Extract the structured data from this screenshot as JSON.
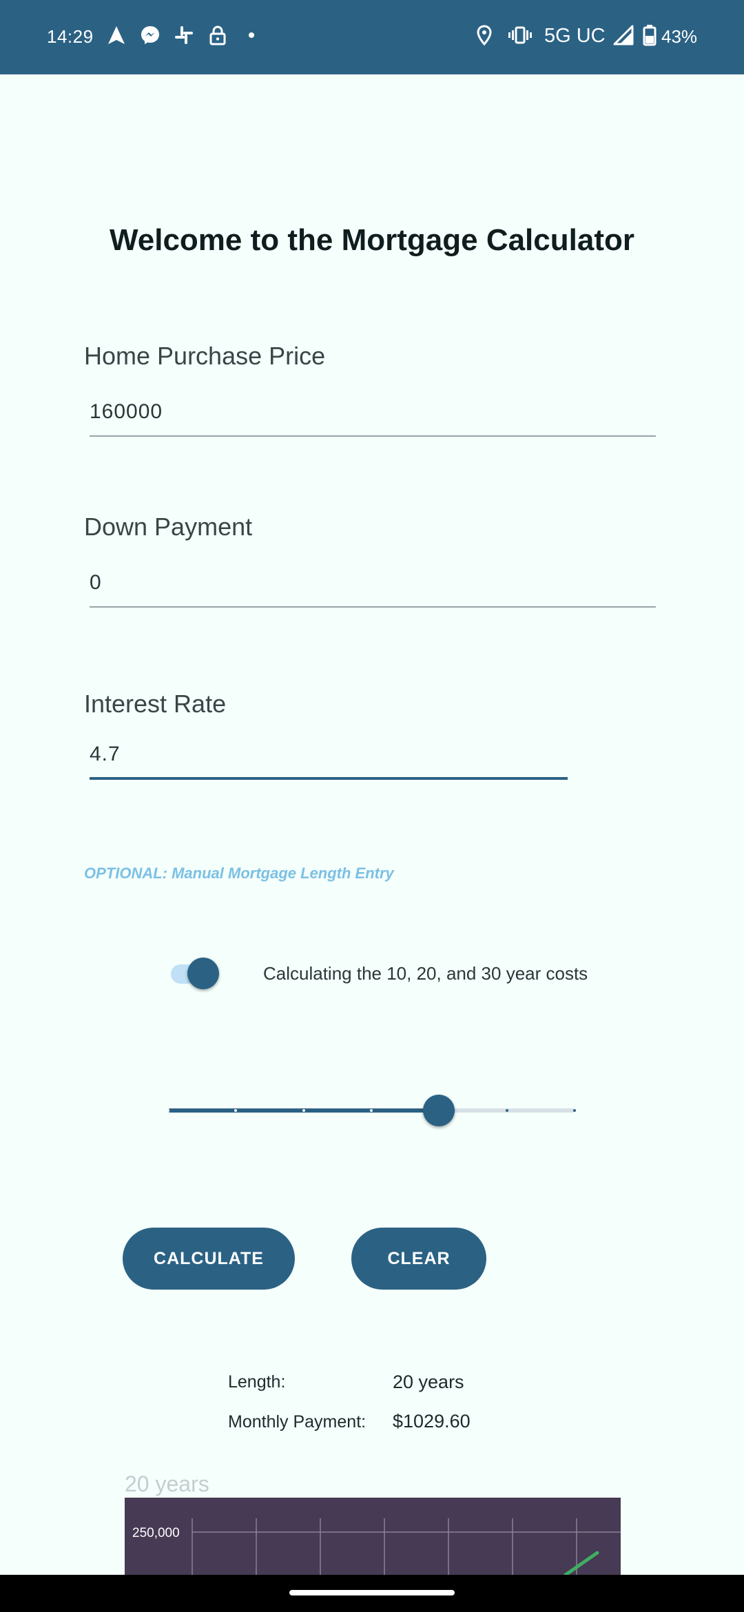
{
  "status_bar": {
    "time": "14:29",
    "network": "5G UC",
    "battery": "43%"
  },
  "page": {
    "title": "Welcome to the Mortgage Calculator"
  },
  "fields": {
    "price": {
      "label": "Home Purchase Price",
      "value": "160000"
    },
    "down_payment": {
      "label": "Down Payment",
      "value": "0"
    },
    "interest_rate": {
      "label": "Interest Rate",
      "value": "4.7"
    }
  },
  "optional_text": "OPTIONAL: Manual Mortgage Length Entry",
  "toggle": {
    "label": "Calculating the 10, 20, and 30 year costs",
    "on": true
  },
  "slider": {
    "steps": 7,
    "selected_index": 4
  },
  "buttons": {
    "calculate": "CALCULATE",
    "clear": "CLEAR"
  },
  "results": {
    "length_label": "Length:",
    "length_value": "20 years",
    "payment_label": "Monthly Payment:",
    "payment_value": "$1029.60"
  },
  "chart_data": {
    "type": "line",
    "title": "20 years",
    "y_tick_labels": [
      "250,000"
    ]
  },
  "colors": {
    "primary": "#2b6284",
    "background": "#f5fffc",
    "optional_text": "#7cc0e4",
    "chart_bg": "#463a54",
    "chart_line": "#3fae62"
  }
}
